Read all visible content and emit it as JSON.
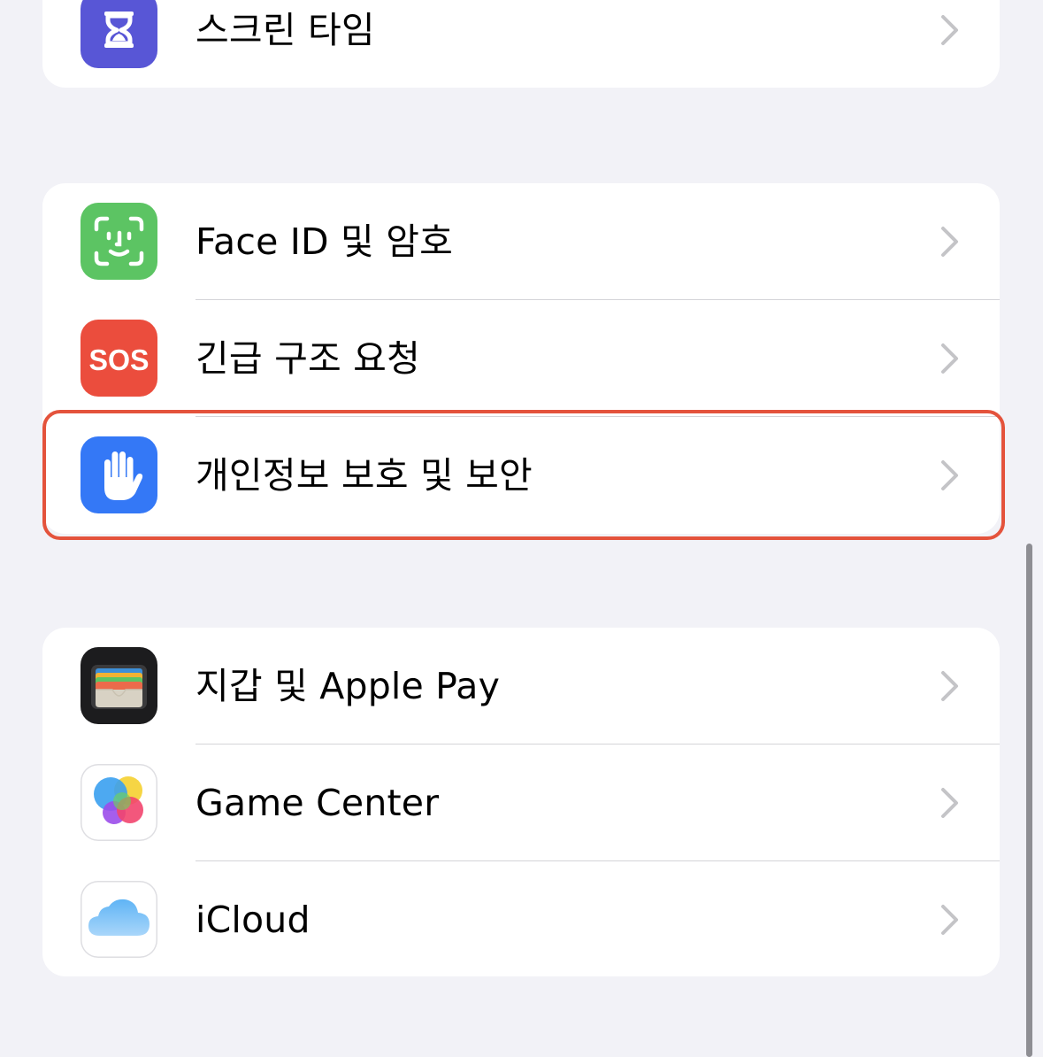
{
  "groups": [
    {
      "items": [
        {
          "label": "스크린 타임",
          "icon": "hourglass-icon",
          "icon_color": "#5856d6"
        }
      ]
    },
    {
      "items": [
        {
          "label": "Face ID 및 암호",
          "icon": "face-id-icon",
          "icon_color": "#5cc463"
        },
        {
          "label": "긴급 구조 요청",
          "icon_text": "SOS",
          "icon": "sos-icon",
          "icon_color": "#eb4d3d"
        },
        {
          "label": "개인정보 보호 및 보안",
          "icon": "hand-icon",
          "icon_color": "#3478f6",
          "highlighted": true
        }
      ]
    },
    {
      "items": [
        {
          "label": "지갑 및 Apple Pay",
          "icon": "wallet-icon",
          "icon_color": "#1c1c1e"
        },
        {
          "label": "Game Center",
          "icon": "game-center-icon",
          "icon_color": "#ffffff"
        },
        {
          "label": "iCloud",
          "icon": "icloud-icon",
          "icon_color": "#ffffff"
        }
      ]
    }
  ],
  "highlight_color": "#e4533c"
}
